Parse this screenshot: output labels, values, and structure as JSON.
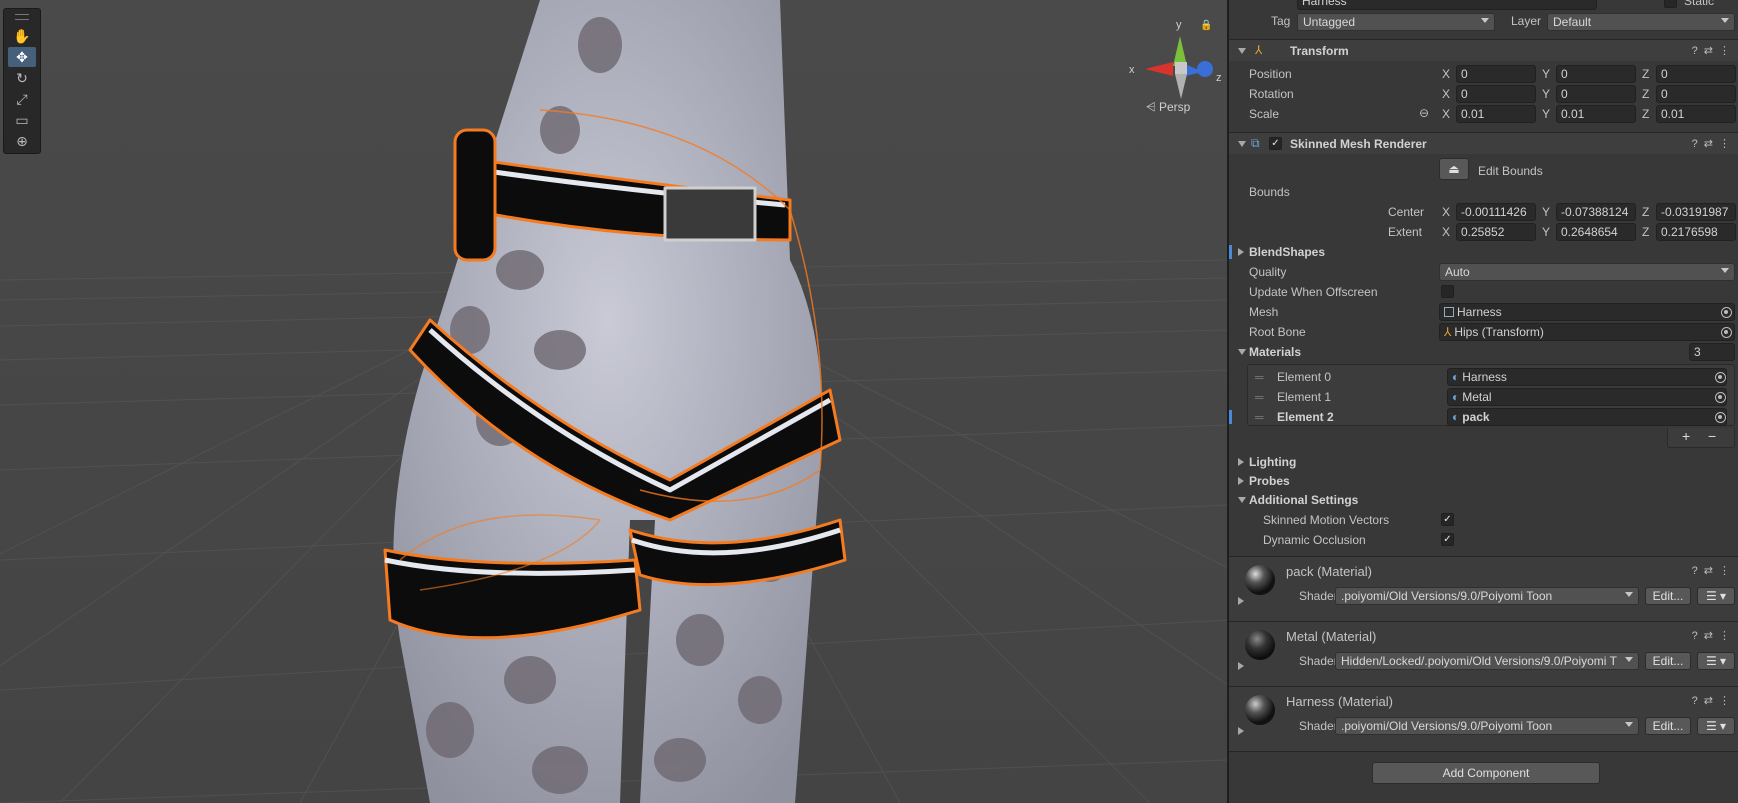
{
  "inspector": {
    "object_name": "Harness",
    "static_label": "Static",
    "tag_label": "Tag",
    "tag_value": "Untagged",
    "layer_label": "Layer",
    "layer_value": "Default",
    "transform": {
      "title": "Transform",
      "position_label": "Position",
      "rotation_label": "Rotation",
      "scale_label": "Scale",
      "axis_x": "X",
      "axis_y": "Y",
      "axis_z": "Z",
      "position": [
        "0",
        "0",
        "0"
      ],
      "rotation": [
        "0",
        "0",
        "0"
      ],
      "scale": [
        "0.01",
        "0.01",
        "0.01"
      ]
    },
    "skinned_mesh_renderer": {
      "title": "Skinned Mesh Renderer",
      "edit_bounds_label": "Edit Bounds",
      "bounds_label": "Bounds",
      "center_label": "Center",
      "extent_label": "Extent",
      "center": [
        "-0.00111426",
        "-0.07388124",
        "-0.03191987"
      ],
      "extent": [
        "0.25852",
        "0.2648654",
        "0.2176598"
      ],
      "blendshapes_label": "BlendShapes",
      "quality_label": "Quality",
      "quality_value": "Auto",
      "update_offscreen_label": "Update When Offscreen",
      "update_offscreen_checked": false,
      "mesh_label": "Mesh",
      "mesh_value": "Harness",
      "root_bone_label": "Root Bone",
      "root_bone_value": "Hips (Transform)",
      "materials_label": "Materials",
      "materials_count": "3",
      "materials": [
        {
          "label": "Element 0",
          "value": "Harness"
        },
        {
          "label": "Element 1",
          "value": "Metal"
        },
        {
          "label": "Element 2",
          "value": "pack"
        }
      ],
      "add_symbol": "+",
      "remove_symbol": "−",
      "lighting_label": "Lighting",
      "probes_label": "Probes",
      "additional_settings_label": "Additional Settings",
      "skinned_motion_vectors_label": "Skinned Motion Vectors",
      "skinned_motion_vectors_checked": true,
      "dynamic_occlusion_label": "Dynamic Occlusion",
      "dynamic_occlusion_checked": true
    },
    "material_panels": [
      {
        "title": "pack (Material)",
        "shader_label": "Shader",
        "shader": ".poiyomi/Old Versions/9.0/Poiyomi Toon",
        "edit_label": "Edit..."
      },
      {
        "title": "Metal (Material)",
        "shader_label": "Shader",
        "shader": "Hidden/Locked/.poiyomi/Old Versions/9.0/Poiyomi T",
        "edit_label": "Edit..."
      },
      {
        "title": "Harness (Material)",
        "shader_label": "Shader",
        "shader": ".poiyomi/Old Versions/9.0/Poiyomi Toon",
        "edit_label": "Edit..."
      }
    ],
    "add_component_label": "Add Component"
  },
  "scene": {
    "persp_label": "Persp",
    "gizmo_axes": {
      "x": "x",
      "y": "y",
      "z": "z"
    },
    "tools": [
      "hand-tool",
      "move-tool",
      "rotate-tool",
      "scale-tool",
      "rect-tool",
      "transform-tool"
    ],
    "active_tool": "move-tool"
  },
  "colors": {
    "selection_outline": "#f47b20",
    "inspector_bg": "#383838",
    "scene_bg": "#474747",
    "active_tool": "#46607c"
  }
}
